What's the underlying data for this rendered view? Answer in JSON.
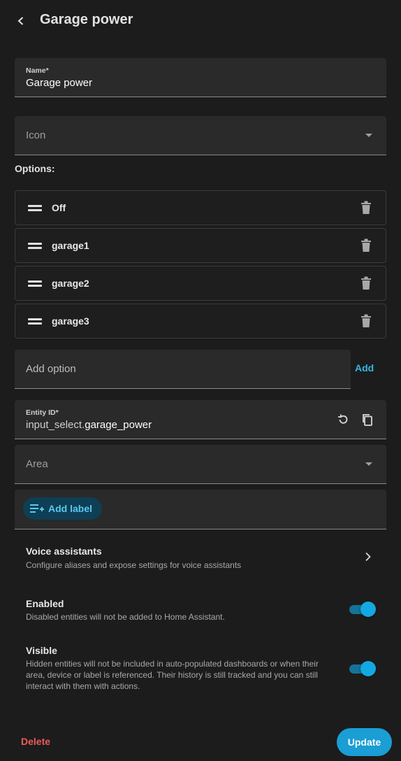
{
  "header": {
    "title": "Garage power"
  },
  "name_field": {
    "label": "Name*",
    "value": "Garage power"
  },
  "icon_field": {
    "placeholder": "Icon"
  },
  "options": {
    "label": "Options:",
    "items": [
      "Off",
      "garage1",
      "garage2",
      "garage3"
    ]
  },
  "add_option": {
    "placeholder": "Add option",
    "button_label": "Add"
  },
  "entity_id": {
    "label": "Entity ID*",
    "prefix": "input_select.",
    "value": "garage_power"
  },
  "area_field": {
    "placeholder": "Area"
  },
  "labels": {
    "add_label": "Add label"
  },
  "voice_assistants": {
    "title": "Voice assistants",
    "subtitle": "Configure aliases and expose settings for voice assistants"
  },
  "enabled": {
    "title": "Enabled",
    "subtitle": "Disabled entities will not be added to Home Assistant.",
    "on": true
  },
  "visible": {
    "title": "Visible",
    "subtitle": "Hidden entities will not be included in auto-populated dashboards or when their area, device or label is referenced. Their history is still tracked and you can still interact with them with actions.",
    "on": true
  },
  "footer": {
    "delete_label": "Delete",
    "update_label": "Update"
  },
  "colors": {
    "accent": "#1a9ed4",
    "danger": "#f05a5a",
    "background": "#1c1c1c"
  }
}
